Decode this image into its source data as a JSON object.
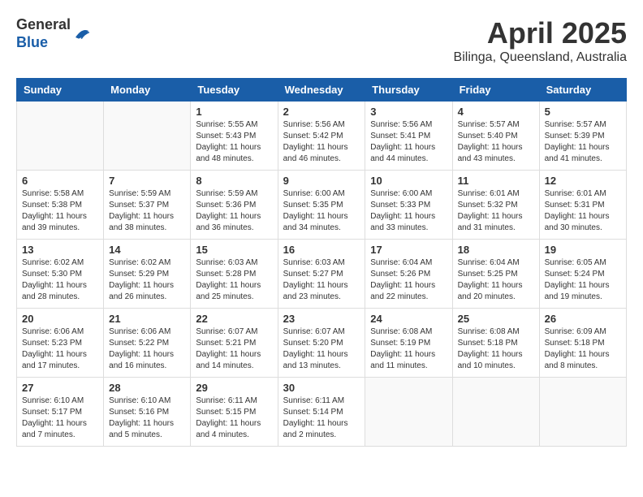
{
  "header": {
    "logo_line1": "General",
    "logo_line2": "Blue",
    "month": "April 2025",
    "location": "Bilinga, Queensland, Australia"
  },
  "columns": [
    "Sunday",
    "Monday",
    "Tuesday",
    "Wednesday",
    "Thursday",
    "Friday",
    "Saturday"
  ],
  "weeks": [
    [
      {
        "day": "",
        "info": ""
      },
      {
        "day": "",
        "info": ""
      },
      {
        "day": "1",
        "info": "Sunrise: 5:55 AM\nSunset: 5:43 PM\nDaylight: 11 hours and 48 minutes."
      },
      {
        "day": "2",
        "info": "Sunrise: 5:56 AM\nSunset: 5:42 PM\nDaylight: 11 hours and 46 minutes."
      },
      {
        "day": "3",
        "info": "Sunrise: 5:56 AM\nSunset: 5:41 PM\nDaylight: 11 hours and 44 minutes."
      },
      {
        "day": "4",
        "info": "Sunrise: 5:57 AM\nSunset: 5:40 PM\nDaylight: 11 hours and 43 minutes."
      },
      {
        "day": "5",
        "info": "Sunrise: 5:57 AM\nSunset: 5:39 PM\nDaylight: 11 hours and 41 minutes."
      }
    ],
    [
      {
        "day": "6",
        "info": "Sunrise: 5:58 AM\nSunset: 5:38 PM\nDaylight: 11 hours and 39 minutes."
      },
      {
        "day": "7",
        "info": "Sunrise: 5:59 AM\nSunset: 5:37 PM\nDaylight: 11 hours and 38 minutes."
      },
      {
        "day": "8",
        "info": "Sunrise: 5:59 AM\nSunset: 5:36 PM\nDaylight: 11 hours and 36 minutes."
      },
      {
        "day": "9",
        "info": "Sunrise: 6:00 AM\nSunset: 5:35 PM\nDaylight: 11 hours and 34 minutes."
      },
      {
        "day": "10",
        "info": "Sunrise: 6:00 AM\nSunset: 5:33 PM\nDaylight: 11 hours and 33 minutes."
      },
      {
        "day": "11",
        "info": "Sunrise: 6:01 AM\nSunset: 5:32 PM\nDaylight: 11 hours and 31 minutes."
      },
      {
        "day": "12",
        "info": "Sunrise: 6:01 AM\nSunset: 5:31 PM\nDaylight: 11 hours and 30 minutes."
      }
    ],
    [
      {
        "day": "13",
        "info": "Sunrise: 6:02 AM\nSunset: 5:30 PM\nDaylight: 11 hours and 28 minutes."
      },
      {
        "day": "14",
        "info": "Sunrise: 6:02 AM\nSunset: 5:29 PM\nDaylight: 11 hours and 26 minutes."
      },
      {
        "day": "15",
        "info": "Sunrise: 6:03 AM\nSunset: 5:28 PM\nDaylight: 11 hours and 25 minutes."
      },
      {
        "day": "16",
        "info": "Sunrise: 6:03 AM\nSunset: 5:27 PM\nDaylight: 11 hours and 23 minutes."
      },
      {
        "day": "17",
        "info": "Sunrise: 6:04 AM\nSunset: 5:26 PM\nDaylight: 11 hours and 22 minutes."
      },
      {
        "day": "18",
        "info": "Sunrise: 6:04 AM\nSunset: 5:25 PM\nDaylight: 11 hours and 20 minutes."
      },
      {
        "day": "19",
        "info": "Sunrise: 6:05 AM\nSunset: 5:24 PM\nDaylight: 11 hours and 19 minutes."
      }
    ],
    [
      {
        "day": "20",
        "info": "Sunrise: 6:06 AM\nSunset: 5:23 PM\nDaylight: 11 hours and 17 minutes."
      },
      {
        "day": "21",
        "info": "Sunrise: 6:06 AM\nSunset: 5:22 PM\nDaylight: 11 hours and 16 minutes."
      },
      {
        "day": "22",
        "info": "Sunrise: 6:07 AM\nSunset: 5:21 PM\nDaylight: 11 hours and 14 minutes."
      },
      {
        "day": "23",
        "info": "Sunrise: 6:07 AM\nSunset: 5:20 PM\nDaylight: 11 hours and 13 minutes."
      },
      {
        "day": "24",
        "info": "Sunrise: 6:08 AM\nSunset: 5:19 PM\nDaylight: 11 hours and 11 minutes."
      },
      {
        "day": "25",
        "info": "Sunrise: 6:08 AM\nSunset: 5:18 PM\nDaylight: 11 hours and 10 minutes."
      },
      {
        "day": "26",
        "info": "Sunrise: 6:09 AM\nSunset: 5:18 PM\nDaylight: 11 hours and 8 minutes."
      }
    ],
    [
      {
        "day": "27",
        "info": "Sunrise: 6:10 AM\nSunset: 5:17 PM\nDaylight: 11 hours and 7 minutes."
      },
      {
        "day": "28",
        "info": "Sunrise: 6:10 AM\nSunset: 5:16 PM\nDaylight: 11 hours and 5 minutes."
      },
      {
        "day": "29",
        "info": "Sunrise: 6:11 AM\nSunset: 5:15 PM\nDaylight: 11 hours and 4 minutes."
      },
      {
        "day": "30",
        "info": "Sunrise: 6:11 AM\nSunset: 5:14 PM\nDaylight: 11 hours and 2 minutes."
      },
      {
        "day": "",
        "info": ""
      },
      {
        "day": "",
        "info": ""
      },
      {
        "day": "",
        "info": ""
      }
    ]
  ]
}
